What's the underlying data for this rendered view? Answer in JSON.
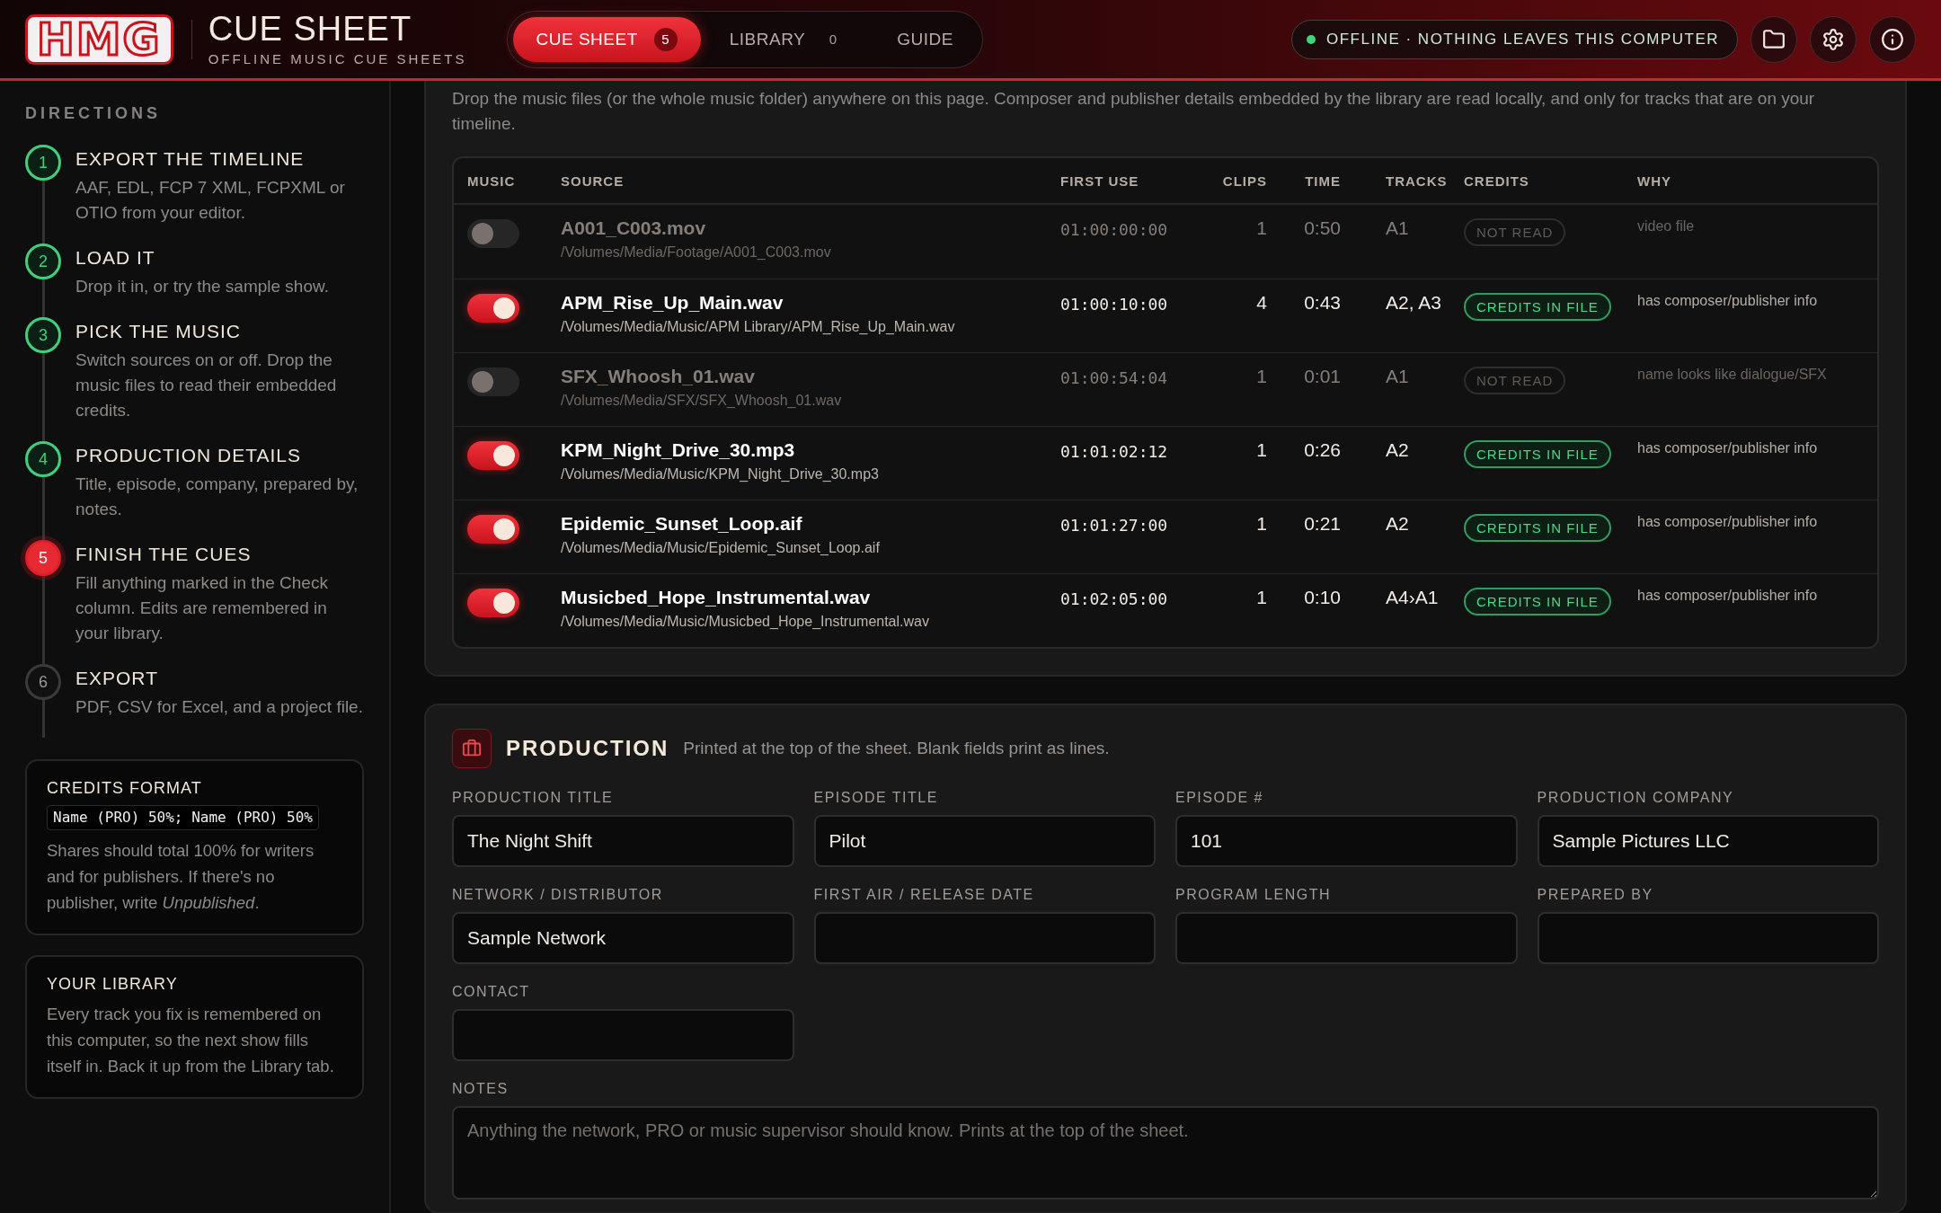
{
  "header": {
    "logo": "HMG",
    "title": "CUE SHEET",
    "subtitle": "OFFLINE MUSIC CUE SHEETS",
    "tabs": [
      {
        "label": "CUE SHEET",
        "count": "5",
        "selected": true
      },
      {
        "label": "LIBRARY",
        "count": "0",
        "selected": false
      },
      {
        "label": "GUIDE",
        "selected": false
      }
    ],
    "status": {
      "label": "OFFLINE · NOTHING LEAVES THIS COMPUTER",
      "online": false
    }
  },
  "sidebar": {
    "heading": "DIRECTIONS",
    "steps": [
      {
        "number": "1",
        "title": "EXPORT THE TIMELINE",
        "text": "AAF, EDL, FCP 7 XML, FCPXML or OTIO from your editor.",
        "done": true,
        "active": false
      },
      {
        "number": "2",
        "title": "LOAD IT",
        "text": "Drop it in, or try the sample show.",
        "done": true,
        "active": false
      },
      {
        "number": "3",
        "title": "PICK THE MUSIC",
        "text": "Switch sources on or off. Drop the music files to read their embedded credits.",
        "done": true,
        "active": false
      },
      {
        "number": "4",
        "title": "PRODUCTION DETAILS",
        "text": "Title, episode, company, prepared by, notes.",
        "done": true,
        "active": false
      },
      {
        "number": "5",
        "title": "FINISH THE CUES",
        "text": "Fill anything marked in the Check column. Edits are remembered in your library.",
        "done": false,
        "active": true
      },
      {
        "number": "6",
        "title": "EXPORT",
        "text": "PDF, CSV for Excel, and a project file.",
        "done": false,
        "active": false
      }
    ],
    "cards": [
      {
        "title": "CREDITS FORMAT",
        "code": "Name (PRO) 50%; Name (PRO) 50%",
        "text": "Shares should total 100% for writers and for publishers. If there's no publisher, write *Unpublished*."
      },
      {
        "title": "YOUR LIBRARY",
        "text": "Every track you fix is remembered on this computer, so the next show fills itself in. Back it up from the Library tab."
      }
    ]
  },
  "music": {
    "intro": "Drop the music files (or the whole music folder) anywhere on this page. Composer and publisher details embedded by the library are read locally, and only for tracks that are on your timeline.",
    "table": {
      "columns": [
        "MUSIC",
        "SOURCE",
        "FIRST USE",
        "CLIPS",
        "TIME",
        "TRACKS",
        "CREDITS",
        "WHY"
      ],
      "rows": [
        {
          "on": false,
          "name": "A001_C003.mov",
          "path": "/Volumes/Media/Footage/A001_C003.mov",
          "first_use": "01:00:00:00",
          "clips": "1",
          "time": "0:50",
          "tracks": "A1",
          "credits": {
            "label": "NOT READ",
            "found": false
          },
          "why": "video file"
        },
        {
          "on": true,
          "name": "APM_Rise_Up_Main.wav",
          "path": "/Volumes/Media/Music/APM Library/APM_Rise_Up_Main.wav",
          "first_use": "01:00:10:00",
          "clips": "4",
          "time": "0:43",
          "tracks": "A2, A3",
          "credits": {
            "label": "CREDITS IN FILE",
            "found": true
          },
          "why": "has composer/publisher info"
        },
        {
          "on": false,
          "name": "SFX_Whoosh_01.wav",
          "path": "/Volumes/Media/SFX/SFX_Whoosh_01.wav",
          "first_use": "01:00:54:04",
          "clips": "1",
          "time": "0:01",
          "tracks": "A1",
          "credits": {
            "label": "NOT READ",
            "found": false
          },
          "why": "name looks like dialogue/SFX"
        },
        {
          "on": true,
          "name": "KPM_Night_Drive_30.mp3",
          "path": "/Volumes/Media/Music/KPM_Night_Drive_30.mp3",
          "first_use": "01:01:02:12",
          "clips": "1",
          "time": "0:26",
          "tracks": "A2",
          "credits": {
            "label": "CREDITS IN FILE",
            "found": true
          },
          "why": "has composer/publisher info"
        },
        {
          "on": true,
          "name": "Epidemic_Sunset_Loop.aif",
          "path": "/Volumes/Media/Music/Epidemic_Sunset_Loop.aif",
          "first_use": "01:01:27:00",
          "clips": "1",
          "time": "0:21",
          "tracks": "A2",
          "credits": {
            "label": "CREDITS IN FILE",
            "found": true
          },
          "why": "has composer/publisher info"
        },
        {
          "on": true,
          "name": "Musicbed_Hope_Instrumental.wav",
          "path": "/Volumes/Media/Music/Musicbed_Hope_Instrumental.wav",
          "first_use": "01:02:05:00",
          "clips": "1",
          "time": "0:10",
          "tracks": "A4›A1",
          "credits": {
            "label": "CREDITS IN FILE",
            "found": true
          },
          "why": "has composer/publisher info"
        }
      ]
    }
  },
  "production": {
    "title": "PRODUCTION",
    "hint": "Printed at the top of the sheet. Blank fields print as lines.",
    "fields": [
      {
        "label": "PRODUCTION TITLE",
        "value": "The Night Shift"
      },
      {
        "label": "EPISODE TITLE",
        "value": "Pilot"
      },
      {
        "label": "EPISODE #",
        "value": "101"
      },
      {
        "label": "PRODUCTION COMPANY",
        "value": "Sample Pictures LLC"
      },
      {
        "label": "NETWORK / DISTRIBUTOR",
        "value": "Sample Network"
      },
      {
        "label": "FIRST AIR / RELEASE DATE"
      },
      {
        "label": "PROGRAM LENGTH"
      },
      {
        "label": "PREPARED BY"
      },
      {
        "label": "CONTACT"
      }
    ],
    "notes": {
      "label": "NOTES",
      "placeholder": "Anything the network, PRO or music supervisor should know. Prints at the top of the sheet."
    }
  }
}
